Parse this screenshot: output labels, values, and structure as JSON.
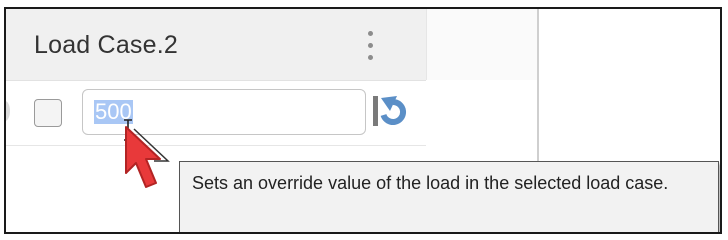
{
  "column": {
    "title": "Load Case.2",
    "menu_icon": "kebab-menu-icon"
  },
  "row": {
    "checkbox_checked": false,
    "value": "500",
    "reset_icon": "reset-override-icon"
  },
  "tooltip": {
    "text": "Sets an override value of the load in the selected load case."
  },
  "colors": {
    "selection": "#a9c7f5",
    "cursor_arrow": "#e8393a",
    "reset_icon": "#5b8fc7"
  }
}
